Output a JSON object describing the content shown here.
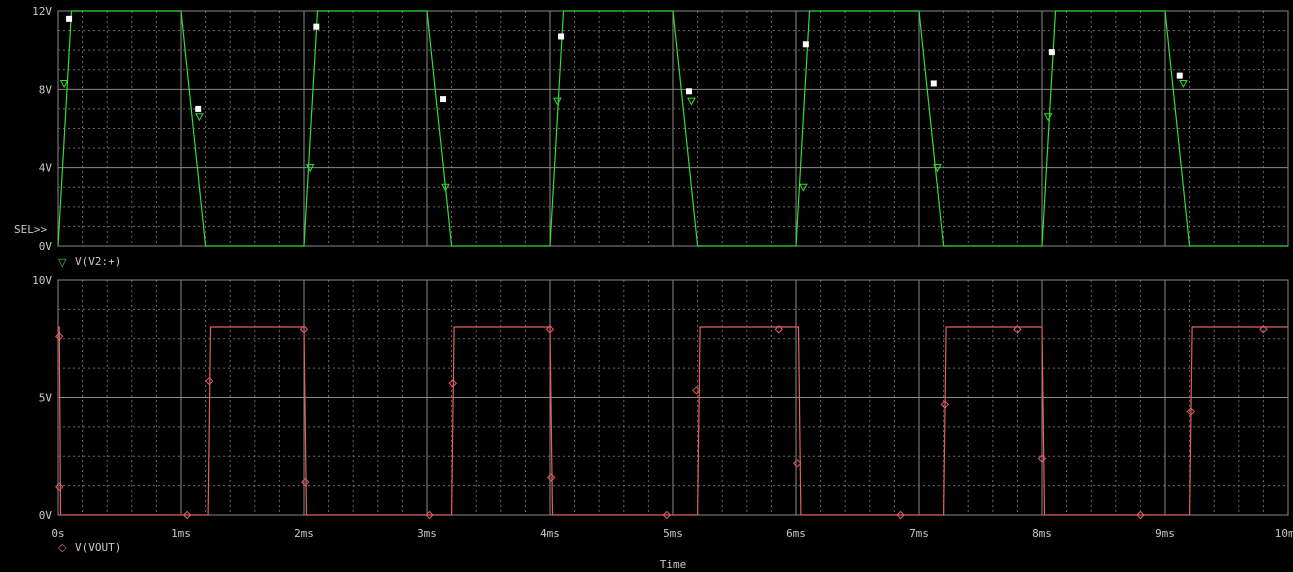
{
  "chart_data": [
    {
      "type": "line",
      "title": "",
      "xlabel": "",
      "ylabel": "",
      "xlim": [
        0,
        10
      ],
      "ylim": [
        0,
        12
      ],
      "yticks": [
        "0V",
        "4V",
        "8V",
        "12V"
      ],
      "yticks_values": [
        0,
        4,
        8,
        12
      ],
      "sel_marker": "SEL>>",
      "grid": true,
      "color": "#33dd33",
      "legend_symbol": "▽",
      "series": [
        {
          "name": "V(V2:+)",
          "x": [
            0,
            0.11,
            1.0,
            1.2,
            2.0,
            2.11,
            3.0,
            3.2,
            4.0,
            4.11,
            5.0,
            5.2,
            6.0,
            6.11,
            7.0,
            7.2,
            8.0,
            8.11,
            9.0,
            9.2,
            10.0
          ],
          "y": [
            0,
            12,
            12,
            0,
            0,
            12,
            12,
            0,
            0,
            12,
            12,
            0,
            0,
            12,
            12,
            0,
            0,
            12,
            12,
            0,
            0
          ]
        }
      ],
      "markers": {
        "x": [
          0.05,
          1.15,
          2.05,
          3.15,
          4.06,
          5.15,
          6.06,
          7.15,
          8.05,
          9.15
        ],
        "y": [
          8.3,
          6.6,
          4.0,
          3.0,
          7.4,
          7.4,
          3.0,
          4.0,
          6.6,
          8.3
        ]
      },
      "squares": {
        "x": [
          0.09,
          1.14,
          2.1,
          3.13,
          4.09,
          5.13,
          6.08,
          7.12,
          8.08,
          9.12
        ],
        "y": [
          11.6,
          7.0,
          11.2,
          7.5,
          10.7,
          7.9,
          10.3,
          8.3,
          9.9,
          8.7
        ]
      }
    },
    {
      "type": "line",
      "title": "",
      "xlabel": "Time",
      "ylabel": "",
      "xlim": [
        0,
        10
      ],
      "ylim": [
        0,
        10
      ],
      "yticks": [
        "0V",
        "5V",
        "10V"
      ],
      "yticks_values": [
        0,
        5,
        10
      ],
      "xticks": [
        "0s",
        "1ms",
        "2ms",
        "3ms",
        "4ms",
        "5ms",
        "6ms",
        "7ms",
        "8ms",
        "9ms",
        "10ms"
      ],
      "xticks_values": [
        0,
        1,
        2,
        3,
        4,
        5,
        6,
        7,
        8,
        9,
        10
      ],
      "grid": true,
      "color": "#e06060",
      "legend_symbol": "◇",
      "series": [
        {
          "name": "V(VOUT)",
          "x": [
            0,
            0.01,
            0.02,
            1.22,
            1.24,
            2.0,
            2.02,
            3.2,
            3.22,
            4.0,
            4.02,
            5.2,
            5.22,
            6.02,
            6.04,
            7.2,
            7.22,
            8.0,
            8.02,
            9.2,
            9.22,
            10.0
          ],
          "y": [
            8,
            8,
            0,
            0,
            8,
            8,
            0,
            0,
            8,
            8,
            0,
            0,
            8,
            8,
            0,
            0,
            8,
            8,
            0,
            0,
            8,
            8
          ]
        }
      ],
      "markers": {
        "x": [
          0.01,
          0.01,
          1.05,
          1.23,
          2.0,
          2.01,
          3.02,
          3.21,
          4.0,
          4.01,
          4.95,
          5.19,
          5.86,
          6.01,
          6.85,
          7.21,
          7.8,
          8.0,
          8.8,
          9.21,
          9.8
        ],
        "y": [
          7.6,
          1.2,
          0,
          5.7,
          7.9,
          1.4,
          0,
          5.6,
          7.9,
          1.6,
          0,
          5.3,
          7.9,
          2.2,
          0,
          4.7,
          7.9,
          2.4,
          0,
          4.4,
          7.9
        ]
      }
    }
  ]
}
